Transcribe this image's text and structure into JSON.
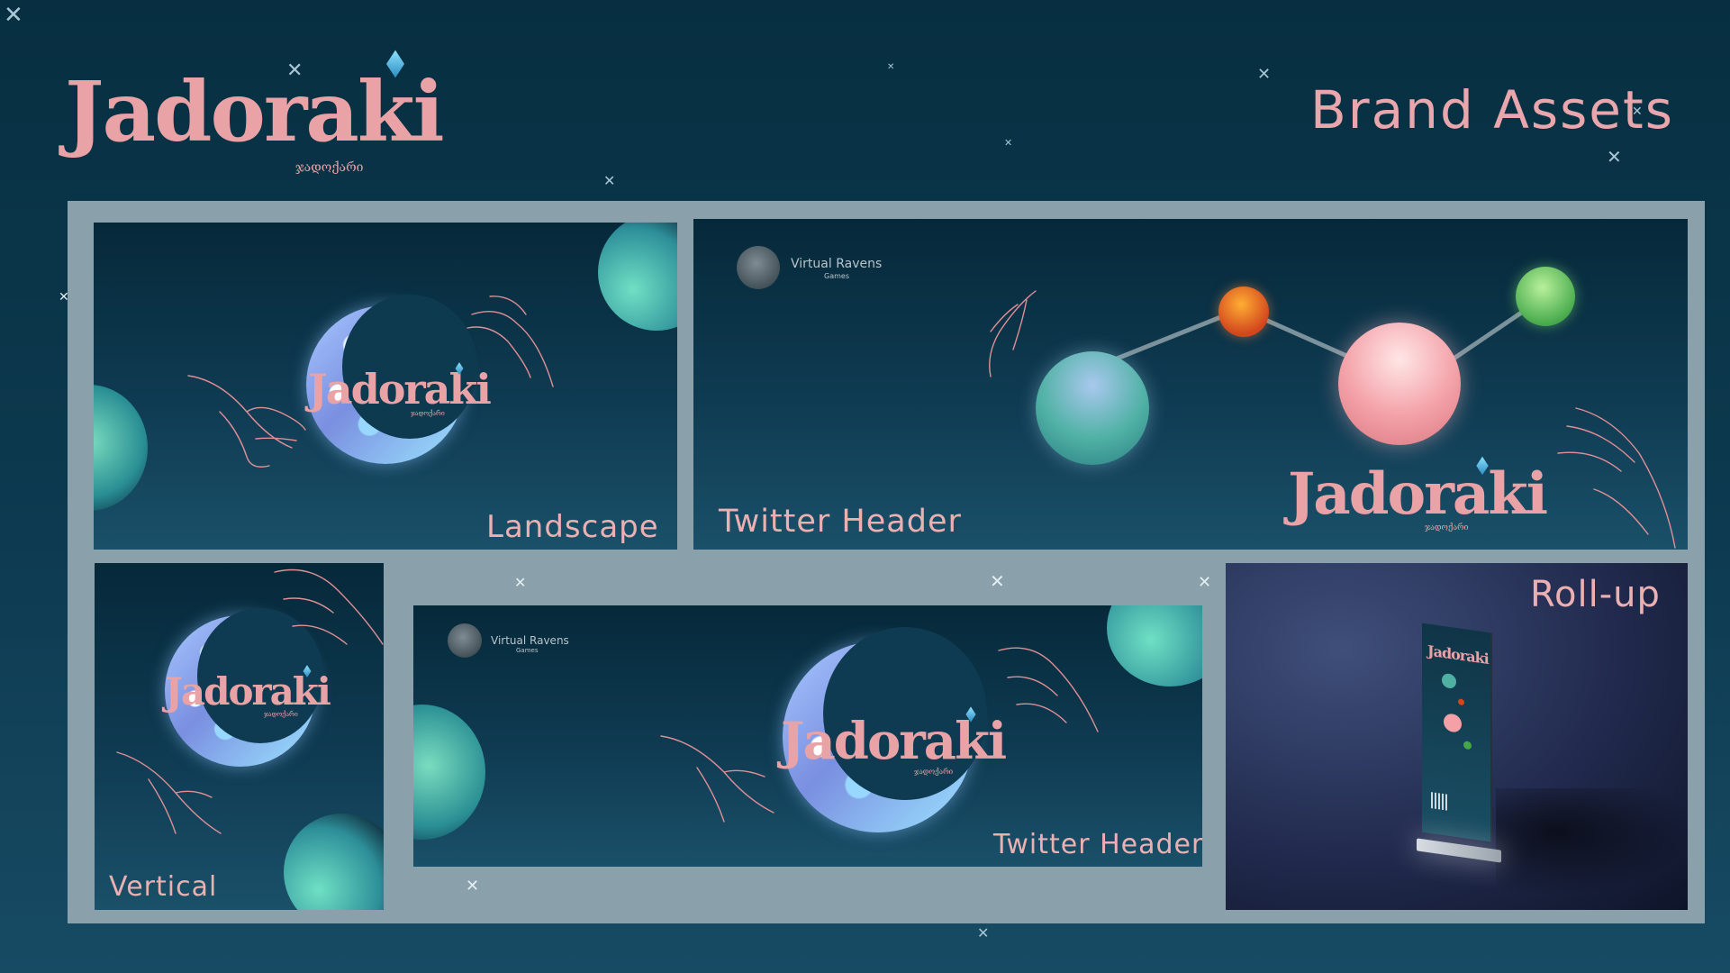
{
  "logo": {
    "name": "Jadoraki",
    "subtitle": "ჯადოქარი"
  },
  "page_title": "Brand Assets",
  "publisher": {
    "name": "Virtual Ravens",
    "tagline": "Games"
  },
  "assets": [
    {
      "label": "Landscape"
    },
    {
      "label": "Twitter Header"
    },
    {
      "label": "Vertical"
    },
    {
      "label": "Twitter Header"
    },
    {
      "label": "Roll-up"
    }
  ],
  "colors": {
    "background": "#0d3a50",
    "frame": "#8aa0ab",
    "brand_pink": "#e9a2a6",
    "accent_gem": "#4aa8d8"
  },
  "icons": [
    "star-icon",
    "gem-icon",
    "raven-icon",
    "hand-outline",
    "crescent-moon",
    "planet"
  ]
}
